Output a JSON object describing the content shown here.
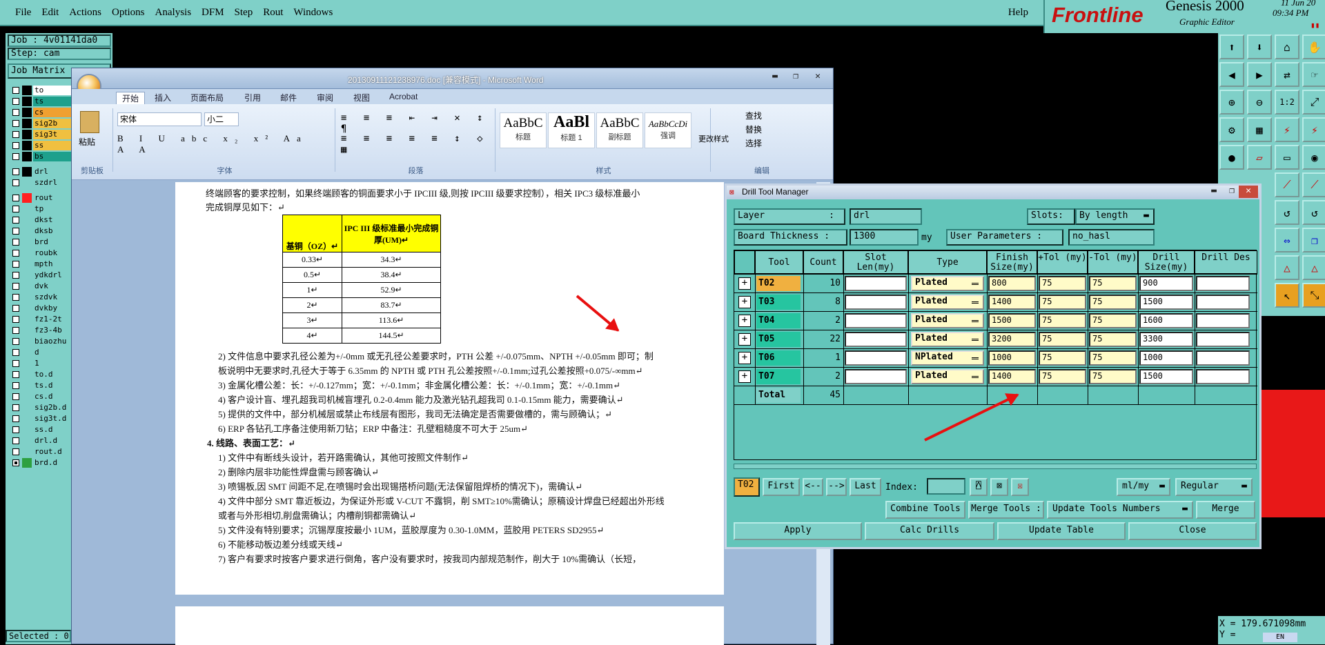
{
  "genesis": {
    "menu": [
      "File",
      "Edit",
      "Actions",
      "Options",
      "Analysis",
      "DFM",
      "Step",
      "Rout",
      "Windows"
    ],
    "help": "Help",
    "logo": {
      "brand": "Frontline",
      "product": "Genesis 2000",
      "subtitle": "Graphic Editor",
      "date": "11 Jun 20",
      "time": "09:34 PM"
    },
    "job": "Job : 4v01141da0",
    "step": "Step: cam",
    "job_matrix": "Job Matrix",
    "layers": [
      {
        "name": "to",
        "color": "#ffffff"
      },
      {
        "name": "ts",
        "color": "#1ea08c"
      },
      {
        "name": "cs",
        "color": "#f0a030"
      },
      {
        "name": "sig2b",
        "color": "#f0c040"
      },
      {
        "name": "sig3t",
        "color": "#f0c040"
      },
      {
        "name": "ss",
        "color": "#f0c040"
      },
      {
        "name": "bs",
        "color": "#1ea08c"
      },
      {
        "name": "drl",
        "color": "#7fd0c8"
      },
      {
        "name": "szdrl",
        "color": "#7fd0c8"
      },
      {
        "name": "rout",
        "color": "#ff2020"
      },
      {
        "name": "tp",
        "color": "#7fd0c8"
      },
      {
        "name": "dkst",
        "color": "#7fd0c8"
      },
      {
        "name": "dksb",
        "color": "#7fd0c8"
      },
      {
        "name": "brd",
        "color": "#7fd0c8"
      },
      {
        "name": "roubk",
        "color": "#7fd0c8"
      },
      {
        "name": "mpth",
        "color": "#7fd0c8"
      },
      {
        "name": "ydkdrl",
        "color": "#7fd0c8"
      },
      {
        "name": "dvk",
        "color": "#7fd0c8"
      },
      {
        "name": "szdvk",
        "color": "#7fd0c8"
      },
      {
        "name": "dvkby",
        "color": "#7fd0c8"
      },
      {
        "name": "fz1-2t",
        "color": "#7fd0c8"
      },
      {
        "name": "fz3-4b",
        "color": "#7fd0c8"
      },
      {
        "name": "biaozhu",
        "color": "#7fd0c8"
      },
      {
        "name": "d",
        "color": "#7fd0c8"
      },
      {
        "name": "1",
        "color": "#7fd0c8"
      },
      {
        "name": "to.d",
        "color": "#7fd0c8"
      },
      {
        "name": "ts.d",
        "color": "#7fd0c8"
      },
      {
        "name": "cs.d",
        "color": "#7fd0c8"
      },
      {
        "name": "sig2b.d",
        "color": "#7fd0c8"
      },
      {
        "name": "sig3t.d",
        "color": "#7fd0c8"
      },
      {
        "name": "ss.d",
        "color": "#7fd0c8"
      },
      {
        "name": "drl.d",
        "color": "#7fd0c8"
      },
      {
        "name": "rout.d",
        "color": "#7fd0c8"
      },
      {
        "name": "brd.d",
        "color": "#2ea040"
      }
    ],
    "selected": "Selected : 0",
    "coords": {
      "x": "X = 179.671098mm",
      "y": "Y ="
    },
    "tray": "EN"
  },
  "word": {
    "title": "20130911121238976.doc [兼容模式] - Microsoft Word",
    "tabs": [
      "开始",
      "插入",
      "页面布局",
      "引用",
      "邮件",
      "审阅",
      "视图",
      "Acrobat"
    ],
    "font_name": "宋体",
    "font_size": "小二",
    "paste": "粘贴",
    "groups": [
      "剪贴板",
      "字体",
      "段落",
      "样式",
      "编辑"
    ],
    "styles": [
      {
        "sample": "AaBbC",
        "label": "标题"
      },
      {
        "sample": "AaBl",
        "label": "标题 1"
      },
      {
        "sample": "AaBbC",
        "label": "副标题"
      },
      {
        "sample": "AaBbCcDi",
        "label": "强调"
      }
    ],
    "change_styles": "更改样式",
    "edit_items": [
      "查找",
      "替换",
      "选择"
    ],
    "lines_top": [
      "终端顾客的要求控制，如果终端顾客的铜面要求小于 IPCIII 级,则按 IPCIII 级要求控制），相关 IPC3 级标准最小",
      "完成铜厚见如下：↵"
    ],
    "table": {
      "headers": [
        "基铜（OZ）↵",
        "IPC III 级标准最小完成铜厚(UM)↵"
      ],
      "rows": [
        [
          "0.33↵",
          "34.3↵"
        ],
        [
          "0.5↵",
          "38.4↵"
        ],
        [
          "1↵",
          "52.9↵"
        ],
        [
          "2↵",
          "83.7↵"
        ],
        [
          "3↵",
          "113.6↵"
        ],
        [
          "4↵",
          "144.5↵"
        ]
      ]
    },
    "lines_mid": [
      "2)  文件信息中要求孔径公差为+/-0mm 或无孔径公差要求时，PTH 公差 +/-0.075mm、NPTH +/-0.05mm 即可；制",
      "     板说明中无要求时,孔径大于等于 6.35mm 的 NPTH 或 PTH 孔公差按照+/-0.1mm;过孔公差按照+0.075/-∞mm↵",
      "3)  金属化槽公差：长：+/-0.127mm；宽：+/-0.1mm；非金属化槽公差：长：+/-0.1mm；宽：+/-0.1mm↵",
      "4)  客户设计盲、埋孔超我司机械盲埋孔 0.2-0.4mm 能力及激光钻孔超我司 0.1-0.15mm 能力，需要确认↵",
      "5)  提供的文件中，部分机械层或禁止布线层有图形，我司无法确定是否需要做槽的，需与顾确认；↵",
      "6)  ERP 各钻孔工序备注使用新刀钻；ERP 中备注：孔壁粗糙度不可大于 25um↵"
    ],
    "section4": "4.  线路、表面工艺：↵",
    "lines_s4": [
      "1)  文件中有断线头设计，若开路需确认，其他可按照文件制作↵",
      "2)  删除内层非功能性焊盘需与顾客确认↵",
      "3)  喷锡板,因 SMT 间距不足,在喷锡时会出现锡搭桥问题(无法保留阻焊桥的情况下)，需确认↵",
      "4)  文件中部分 SMT 靠近板边，为保证外形或 V-CUT 不露铜，削 SMT≥10%需确认；原稿设计焊盘已经超出外形线",
      "     或者与外形相切,削盘需确认；内槽削铜都需确认↵",
      "5)  文件没有特别要求；沉锡厚度按最小 1UM，蓝胶厚度为 0.30-1.0MM，蓝胶用 PETERS   SD2955↵",
      "6)  不能移动板边差分线或天线↵",
      "7)  客户有要求时按客户要求进行倒角，客户没有要求时，按我司内部规范制作，削大于  10%需确认（长短，"
    ]
  },
  "dtm": {
    "title": "Drill Tool Manager",
    "layer_label": "Layer",
    "layer_colon": ":",
    "layer_value": "drl",
    "slots_label": "Slots:",
    "slots_value": "By length",
    "board_label": "Board Thickness :",
    "board_value": "1300",
    "board_unit": "my",
    "user_params_label": "User Parameters :",
    "user_params_value": "no_hasl",
    "columns": [
      "Tool",
      "Count",
      "Slot Len(my)",
      "Type",
      "Finish Size(my)",
      "+Tol (my)",
      "-Tol (my)",
      "Drill Size(my)",
      "Drill Des"
    ],
    "rows": [
      {
        "tool": "T02",
        "count": "10",
        "type": "Plated",
        "finish": "800",
        "ptol": "75",
        "ntol": "75",
        "drill": "900",
        "selected": true
      },
      {
        "tool": "T03",
        "count": "8",
        "type": "Plated",
        "finish": "1400",
        "ptol": "75",
        "ntol": "75",
        "drill": "1500",
        "selected": false
      },
      {
        "tool": "T04",
        "count": "2",
        "type": "Plated",
        "finish": "1500",
        "ptol": "75",
        "ntol": "75",
        "drill": "1600",
        "selected": false
      },
      {
        "tool": "T05",
        "count": "22",
        "type": "Plated",
        "finish": "3200",
        "ptol": "75",
        "ntol": "75",
        "drill": "3300",
        "selected": false
      },
      {
        "tool": "T06",
        "count": "1",
        "type": "NPlated",
        "finish": "1000",
        "ptol": "75",
        "ntol": "75",
        "drill": "1000",
        "selected": false
      },
      {
        "tool": "T07",
        "count": "2",
        "type": "Plated",
        "finish": "1400",
        "ptol": "75",
        "ntol": "75",
        "drill": "1500",
        "selected": false
      }
    ],
    "total_label": "Total",
    "total_value": "45",
    "nav": {
      "current": "T02",
      "first": "First",
      "prev": "<--",
      "next": "-->",
      "last": "Last",
      "index_label": "Index:",
      "units": "ml/my",
      "mode": "Regular"
    },
    "actions1": {
      "combine": "Combine Tools",
      "merge_tools": "Merge Tools :",
      "update_numbers": "Update Tools Numbers",
      "merge": "Merge"
    },
    "actions2": {
      "apply": "Apply",
      "calc": "Calc Drills",
      "update_table": "Update Table",
      "close": "Close"
    }
  }
}
